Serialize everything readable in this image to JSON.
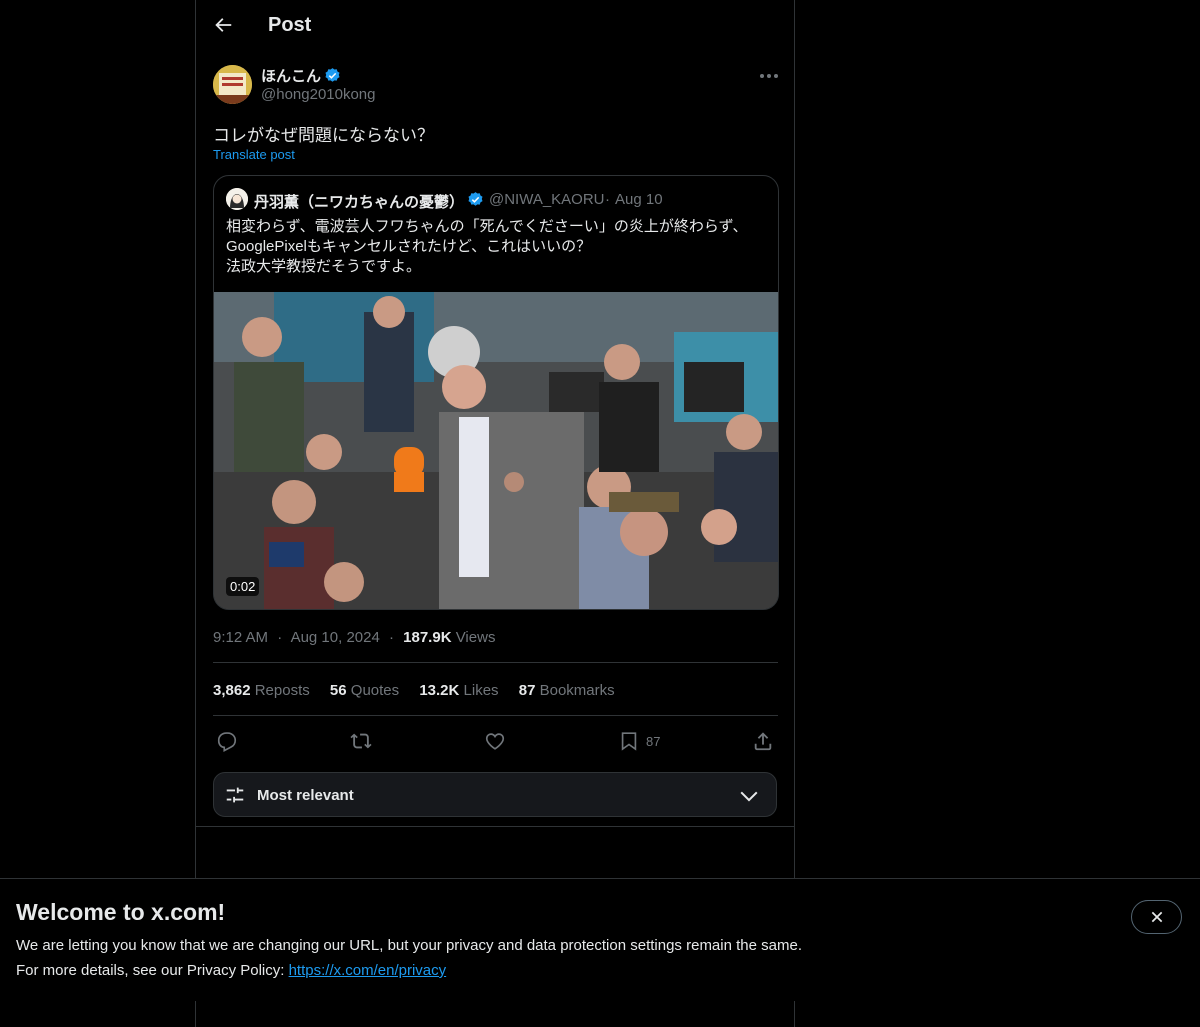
{
  "header": {
    "title": "Post"
  },
  "post": {
    "author_name": "ほんこん",
    "handle": "@hong2010kong",
    "text": "コレがなぜ問題にならない？",
    "translate_label": "Translate post",
    "time": "9:12 AM",
    "date": "Aug 10, 2024",
    "views_count": "187.9K",
    "views_label": "Views",
    "stats": {
      "reposts_count": "3,862",
      "reposts_label": "Reposts",
      "quotes_count": "56",
      "quotes_label": "Quotes",
      "likes_count": "13.2K",
      "likes_label": "Likes",
      "bookmarks_count": "87",
      "bookmarks_label": "Bookmarks"
    },
    "bookmark_action_count": "87"
  },
  "quote": {
    "author_name": "丹羽薫（ニワカちゃんの憂鬱）",
    "handle": "@NIWA_KAORU",
    "separator": "·",
    "date": "Aug 10",
    "text_lines": [
      "相変わらず、電波芸人フワちゃんの「死んでくださーい」の炎上が終わらず、",
      "GooglePixelもキャンセルされたけど、これはいいの？",
      "法政大学教授だそうですよ。"
    ],
    "video_duration": "0:02"
  },
  "meta_sep": "·",
  "sort": {
    "label": "Most relevant"
  },
  "banner": {
    "title": "Welcome to x.com!",
    "line1": "We are letting you know that we are changing our URL, but your privacy and data protection settings remain the same.",
    "line2_prefix": "For more details, see our Privacy Policy: ",
    "link": "https://x.com/en/privacy"
  },
  "colors": {
    "accent": "#1d9bf0",
    "text": "#e7e9ea",
    "muted": "#71767b",
    "border": "#2f3336",
    "background": "#000000"
  }
}
